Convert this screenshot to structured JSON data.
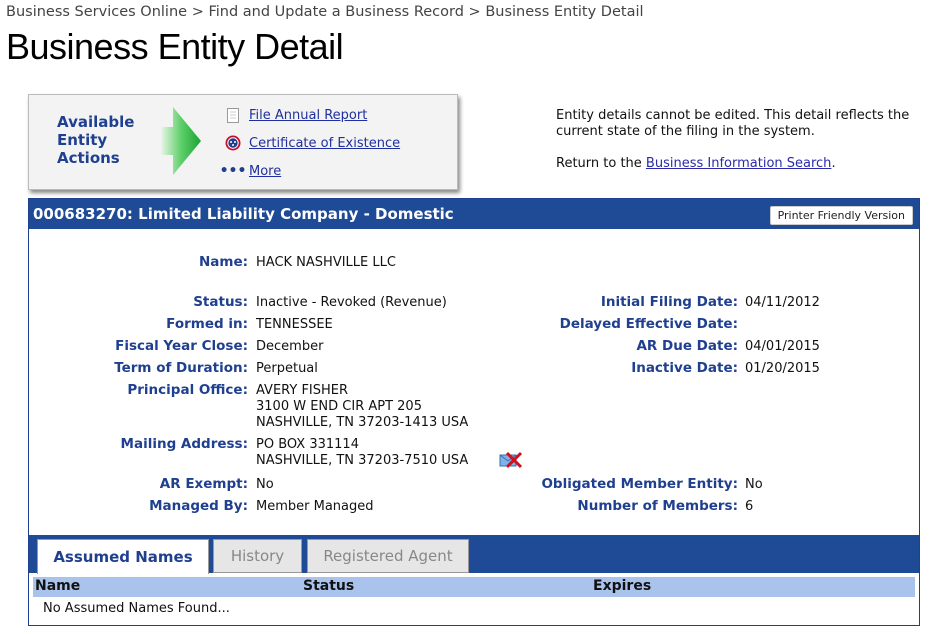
{
  "breadcrumb": {
    "items": [
      "Business Services Online",
      "Find and Update a Business Record",
      "Business Entity Detail"
    ],
    "separator": ">"
  },
  "page_title": "Business Entity Detail",
  "actions": {
    "label_lines": [
      "Available",
      "Entity",
      "Actions"
    ],
    "items": [
      {
        "label": "File Annual Report",
        "icon": "document-icon"
      },
      {
        "label": "Certificate of Existence",
        "icon": "seal-icon"
      },
      {
        "label": "More",
        "icon": "ellipsis-icon"
      }
    ]
  },
  "note": {
    "text": "Entity details cannot be edited. This detail reflects the current state of the filing in the system.",
    "return_prefix": "Return to the ",
    "return_link": "Business Information Search",
    "return_suffix": "."
  },
  "entity": {
    "header": "000683270: Limited Liability Company - Domestic",
    "printer_button": "Printer Friendly Version",
    "name_label": "Name:",
    "name": "HACK NASHVILLE LLC",
    "left_fields": [
      {
        "label": "Status:",
        "lines": [
          "Inactive - Revoked (Revenue)"
        ]
      },
      {
        "label": "Formed in:",
        "lines": [
          "TENNESSEE"
        ]
      },
      {
        "label": "Fiscal Year Close:",
        "lines": [
          "December"
        ]
      },
      {
        "label": "Term of Duration:",
        "lines": [
          "Perpetual"
        ]
      },
      {
        "label": "Principal Office:",
        "lines": [
          "AVERY FISHER",
          "3100 W END CIR APT 205",
          "NASHVILLE, TN 37203-1413 USA"
        ]
      },
      {
        "label": "Mailing Address:",
        "lines": [
          "PO BOX 331114",
          "NASHVILLE, TN 37203-7510 USA"
        ]
      },
      {
        "label": "AR Exempt:",
        "lines": [
          "No"
        ]
      },
      {
        "label": "Managed By:",
        "lines": [
          "Member Managed"
        ]
      }
    ],
    "right_fields": [
      {
        "label": "Initial Filing Date:",
        "value": "04/11/2012"
      },
      {
        "label": "Delayed Effective Date:",
        "value": ""
      },
      {
        "label": "AR Due Date:",
        "value": "04/01/2015"
      },
      {
        "label": "Inactive Date:",
        "value": "01/20/2015"
      },
      {
        "label": "Obligated Member Entity:",
        "value": "No"
      },
      {
        "label": "Number of Members:",
        "value": "6"
      }
    ]
  },
  "tabs": [
    {
      "label": "Assumed Names",
      "active": true
    },
    {
      "label": "History",
      "active": false
    },
    {
      "label": "Registered Agent",
      "active": false
    }
  ],
  "table": {
    "columns": [
      "Name",
      "Status",
      "Expires"
    ],
    "empty_message": "No Assumed Names Found..."
  },
  "colors": {
    "brand_blue": "#1f4a96",
    "label_blue": "#1f3f8f",
    "table_header": "#a9c3ec",
    "arrow_green": "#2db34a"
  }
}
